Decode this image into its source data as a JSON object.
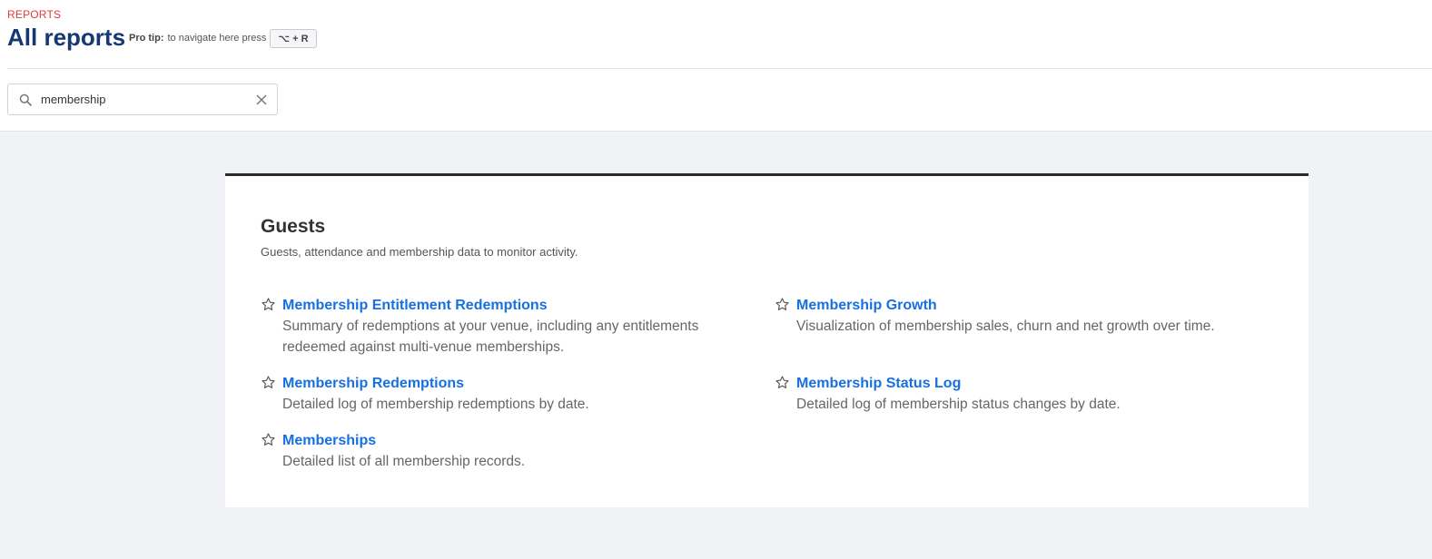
{
  "header": {
    "eyebrow": "REPORTS",
    "title": "All reports",
    "protip_label": "Pro tip:",
    "protip_text": "to navigate here press",
    "shortcut": "⌥ + R"
  },
  "search": {
    "value": "membership",
    "icon": "search-icon",
    "clear_icon": "close-icon"
  },
  "section": {
    "title": "Guests",
    "description": "Guests, attendance and membership data to monitor activity.",
    "reports": [
      {
        "name": "Membership Entitlement Redemptions",
        "description": "Summary of redemptions at your venue, including any entitlements redeemed against multi-venue memberships."
      },
      {
        "name": "Membership Growth",
        "description": "Visualization of membership sales, churn and net growth over time."
      },
      {
        "name": "Membership Redemptions",
        "description": "Detailed log of membership redemptions by date."
      },
      {
        "name": "Membership Status Log",
        "description": "Detailed log of membership status changes by date."
      },
      {
        "name": "Memberships",
        "description": "Detailed list of all membership records."
      }
    ]
  },
  "colors": {
    "accent_red": "#e0393e",
    "title_navy": "#143a73",
    "link_blue": "#1670e0",
    "background": "#f1f2f6"
  }
}
